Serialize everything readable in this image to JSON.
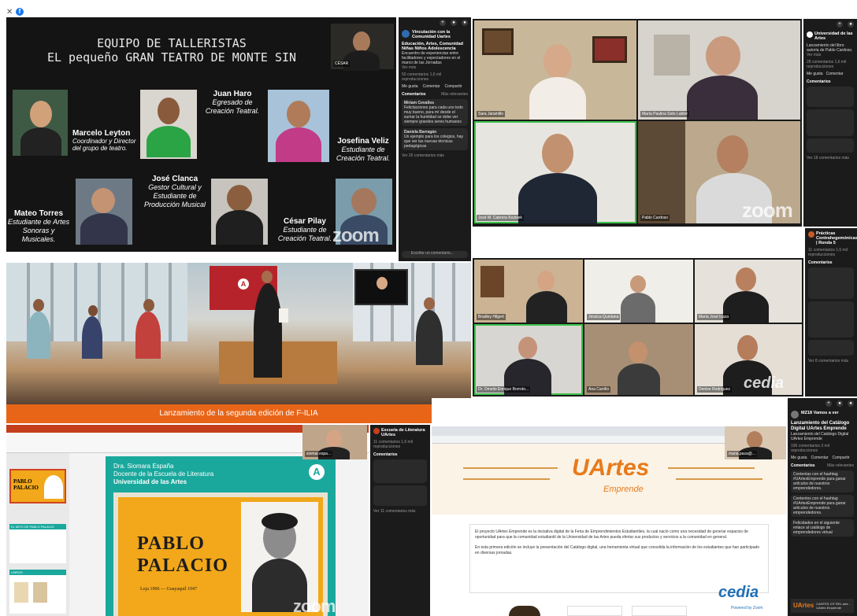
{
  "top_left": {
    "title_line1": "EQUIPO DE TALLERISTAS",
    "title_line2": "EL pequeño GRAN TEATRO DE MONTE SIN",
    "host_name": "CÉSAR",
    "people": [
      {
        "name": "Marcelo Leyton",
        "role": "Coordinador y Director del grupo de teatro."
      },
      {
        "name": "Juan Haro",
        "role": "Egresado de Creación Teatral."
      },
      {
        "name": "Josefina Veliz",
        "role": "Estudiante de Creación Teatral."
      },
      {
        "name": "José Clanca",
        "role": "Gestor Cultural y Estudiante de Producción Musical"
      },
      {
        "name": "Mateo Torres",
        "role": "Estudiante de Artes Sonoras y Musicales."
      },
      {
        "name": "César Pilay",
        "role": "Estudiante de Creación Teatral."
      }
    ],
    "zoom_watermark": "zoom",
    "sidebar": {
      "page_name": "Vinculación con la Comunidad Uartes",
      "post_title": "Educación, Artes, Comunidad Niñas Niños Adolescencia",
      "post_text": "Encuentro de experiencias entre facilitadores y espectadores en el marco de las Jornadas",
      "see_more": "Ver más",
      "reactions": "50 comentarios 1,6 mil reproducciones",
      "like": "Me gusta",
      "comment": "Comentar",
      "share": "Compartir",
      "comments_header": "Comentarios",
      "relevant": "Más relevantes",
      "comment_1_author": "Miriam Cevallos",
      "comment_1": "Felicitaciones para cada uno todo muy bueno, para mí desde el sumar la humildad se debe ver siempre grandes seres humanos",
      "comment_2_author": "Daniela Barragán",
      "comment_2": "Un ejemplo para los colegios, hay que ver las nuevas técnicas pedagógicas",
      "view_more": "Ver 26 comentarios más",
      "write_comment": "Escribe un comentario..."
    }
  },
  "top_right": {
    "participants": [
      "Sara Jaramillo",
      "María Paulina Soto Labbé",
      "José M. Cabrera Kozisek",
      "Pablo Cardoso"
    ],
    "zoom_watermark": "zoom",
    "sidebar": {
      "page_name": "Universidad de las Artes",
      "post_text": "Lanzamiento del libro autoría de Pablo Cardoso.",
      "see_more": "Ver más",
      "reactions": "28 comentarios 1,6 mil reproducciones",
      "like": "Me gusta",
      "comment": "Comentar",
      "share": "Compartir",
      "comments_header": "Comentarios",
      "view_more": "Ver 18 comentarios más"
    }
  },
  "mid_left": {
    "banner": "Lanzamiento de la segunda edición de F-ILIA"
  },
  "mid_right": {
    "participants": [
      "Bradley Hilgert",
      "Jessica Quintana",
      "María José Icaza",
      "Dr. Omelio Enrique Borroto...",
      "Ana Carrillo",
      "Denise Rodríguez"
    ],
    "cedia": "cedia",
    "sidebar": {
      "post_title": "Prácticas Contrahegemónicas | Ronda 5",
      "reactions": "11 comentarios 1,6 mil reproducciones",
      "comments_header": "Comentarios",
      "view_more": "Ver 8 comentarios más"
    }
  },
  "bottom_left": {
    "speaker_name": "Dra. Siomara España",
    "speaker_role": "Docente de la Escuela de Literatura",
    "speaker_org": "Universidad de las Artes",
    "book_title_1": "PABLO",
    "book_title_2": "PALACIO",
    "book_years": "Loja 1906 — Guayaquil 1947",
    "mini_slide_title": "PABLO PALACIO",
    "mini_slide_2": "EL MITO DE PABLO PALACIO",
    "mini_slide_3": "LIBROS",
    "host_tag": "siomar.espa...",
    "zoom_watermark": "zoom",
    "sidebar": {
      "page_name": "Escuela de Literatura UArtes",
      "reactions": "11 comentarios 1,6 mil reproducciones",
      "comments_header": "Comentarios",
      "view_more": "Ver 11 comentarios más"
    }
  },
  "bottom_right": {
    "logo_main": "UArtes",
    "logo_sub": "Emprende",
    "paragraph_1": "El proyecto UArtes Emprende es la iniciativa digital de la Feria de Emprendimientos Estudiantiles, la cual nació como una necesidad de generar espacios de oportunidad para que la comunidad estudiantil de la Universidad de las Artes pueda ofertar sus productos y servicios a la comunidad en general.",
    "paragraph_2": "En esta primera edición se incluye la presentación del Catálogo digital, una herramienta virtual que consolida la información de los estudiantes que han participado en diversas jornadas.",
    "host_tag": "maria.paza@...",
    "cedia": "cedia",
    "powered": "Powered by Zoom",
    "sidebar": {
      "page_name": "MZ18 Vamos a ver",
      "post_title": "Lanzamiento del Catálogo Digital UArtes Emprende",
      "post_text": "Lanzamiento del Catálogo Digital UArtes Emprende",
      "reactions": "196 comentarios 3 mil reproducciones",
      "like": "Me gusta",
      "comment": "Comentar",
      "share": "Compartir",
      "comments_header": "Comentarios",
      "relevant": "Más relevantes",
      "c1": "Contentas con el hashtag #UArtesEmprende para ganar artículos de nuestros emprendedores.",
      "c2": "Contentos con el hashtag #UArtesEmprende para ganar artículos de nuestros emprendedores.",
      "c3": "Felicidades en el siguiente enlace al catálogo de emprendedores virtual",
      "footer_brand": "UArtes",
      "footer_text": "CANTES CIT REL arte - UArtes Emprende"
    }
  }
}
